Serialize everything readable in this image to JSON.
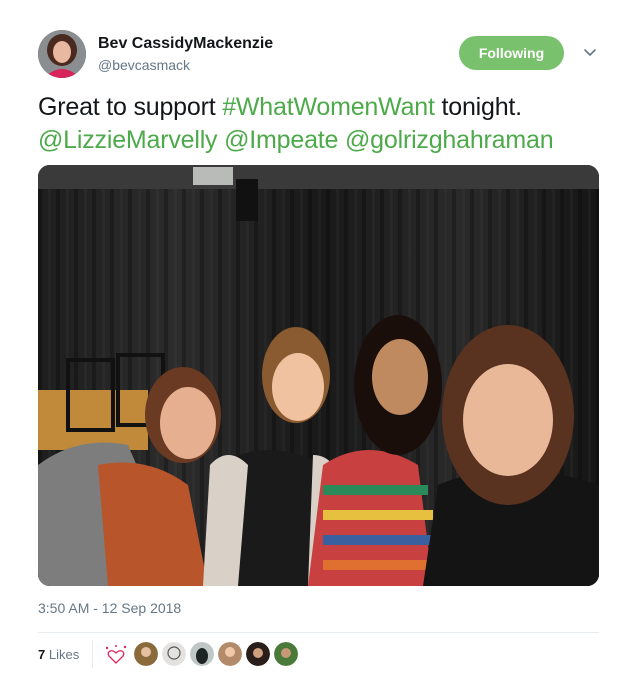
{
  "author": {
    "display_name": "Bev CassidyMackenzie",
    "handle": "@bevcasmack",
    "avatar_icon": "profile-photo"
  },
  "follow_button": {
    "label": "Following",
    "color": "#7ac16e"
  },
  "menu_icon": "chevron-down-icon",
  "tweet": {
    "text_prefix": "Great to support ",
    "hashtag": "#WhatWomenWant",
    "text_mid": " tonight.",
    "mentions": [
      "@LizzieMarvelly",
      "@Impeate",
      "@golrizghahraman"
    ],
    "link_color": "#4daa4a"
  },
  "media": {
    "icon": "photo-image"
  },
  "timestamp": "3:50 AM - 12 Sep 2018",
  "stats": {
    "likes_count": "7",
    "likes_label": " Likes"
  },
  "like_icon": "heart-burst-icon",
  "likers": [
    {
      "name": "liker-avatar-1",
      "color": "#8a6a3a"
    },
    {
      "name": "liker-avatar-2",
      "color": "#c9c4c0"
    },
    {
      "name": "liker-avatar-3",
      "color": "#2f3a3a"
    },
    {
      "name": "liker-avatar-4",
      "color": "#b38a6a"
    },
    {
      "name": "liker-avatar-5",
      "color": "#2a1e1a"
    },
    {
      "name": "liker-avatar-6",
      "color": "#4a7a3a"
    }
  ]
}
